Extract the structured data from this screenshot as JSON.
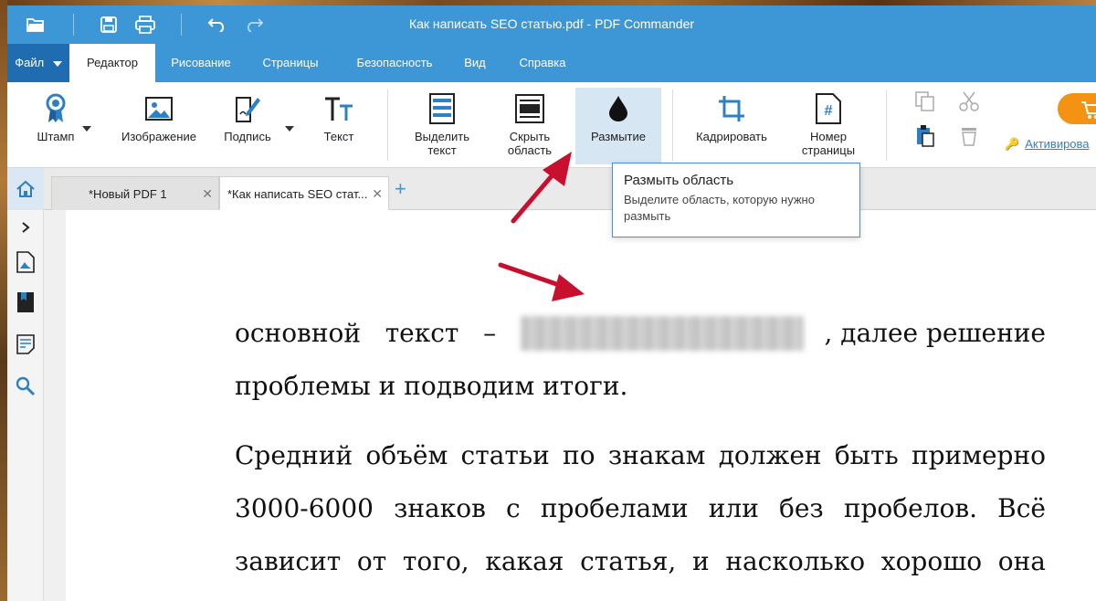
{
  "window": {
    "title": "Как написать SEO статью.pdf - PDF Commander"
  },
  "menu": {
    "file_label": "Файл",
    "tabs": [
      {
        "label": "Редактор",
        "active": true
      },
      {
        "label": "Рисование",
        "active": false
      },
      {
        "label": "Страницы",
        "active": false
      },
      {
        "label": "Безопасность",
        "active": false
      },
      {
        "label": "Вид",
        "active": false
      },
      {
        "label": "Справка",
        "active": false
      }
    ]
  },
  "ribbon": {
    "stamp": "Штамп",
    "image": "Изображение",
    "signature": "Подпись",
    "text": "Текст",
    "highlight_line1": "Выделить",
    "highlight_line2": "текст",
    "hide_line1": "Скрыть",
    "hide_line2": "область",
    "blur": "Размытие",
    "crop": "Кадрировать",
    "page_number_line1": "Номер",
    "page_number_line2": "страницы",
    "activate": "Активирова"
  },
  "tooltip": {
    "title": "Размыть область",
    "description_line1": "Выделите область, которую нужно",
    "description_line2": "размыть"
  },
  "doc_tabs": [
    {
      "label": "*Новый PDF 1",
      "active": false
    },
    {
      "label": "*Как написать SEO стат...",
      "active": true
    }
  ],
  "document": {
    "para1": {
      "line1_words": [
        "основной",
        "текст",
        "–"
      ],
      "line1_after_blur": ", далее решение",
      "line2": "проблемы и подводим итоги."
    },
    "para2": {
      "line1": "Средний объём статьи по знакам должен быть примерно",
      "line2": "3000-6000 знаков с пробелами или без пробелов. Всё",
      "line3": "зависит от того, какая статья, и насколько хорошо она"
    }
  },
  "colors": {
    "accent": "#3d97d6",
    "file_tab": "#1f6db0",
    "buy_button": "#f39213",
    "arrow": "#c8102e",
    "highlight": "#d7e6f3"
  }
}
